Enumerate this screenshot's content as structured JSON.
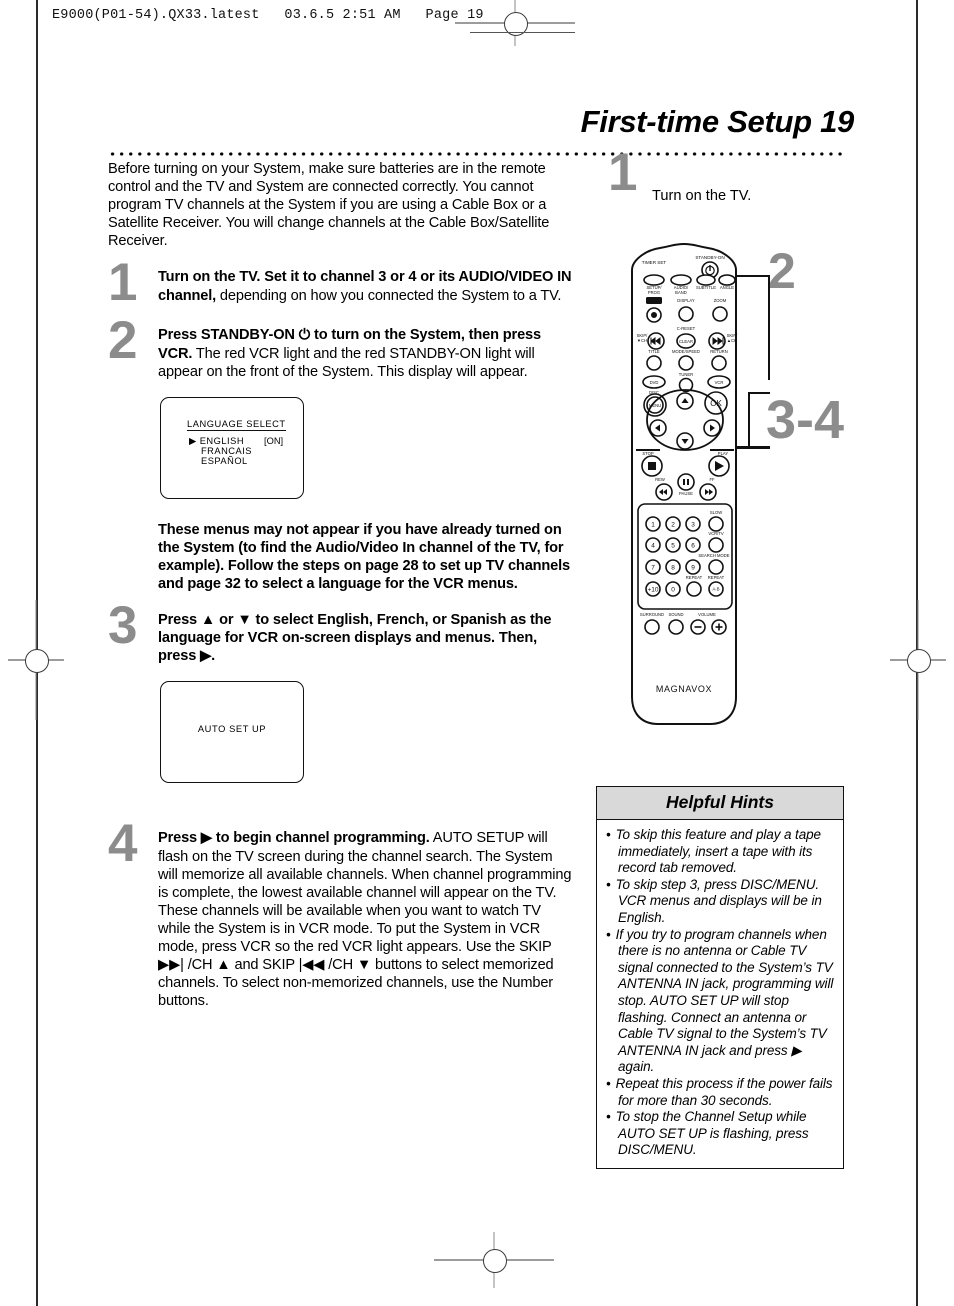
{
  "print_header": "E9000(P01-54).QX33.latest   03.6.5 2:51 AM   Page 19",
  "title": "First-time Setup  19",
  "intro": "Before turning on your System, make sure batteries are in the remote control and the TV and System are connected correctly. You cannot program TV channels at the System if you are using a Cable Box or a Satellite Receiver. You will change channels at the Cable Box/Satellite Receiver.",
  "steps": [
    {
      "number": "1",
      "bold": "Turn on the TV. Set it to channel 3 or 4 or its AUDIO/VIDEO IN channel,",
      "rest": " depending on how you connected the System to a TV."
    },
    {
      "number": "2",
      "bold": "Press STANDBY-ON ⏻ to turn on the System, then press VCR.",
      "rest": " The red VCR light and the red STANDBY-ON light will appear on the front of the System. This display will appear."
    },
    {
      "number": "3",
      "bold": "Press ▲ or ▼ to select English, French, or Spanish as the language for VCR on-screen displays and menus. Then, press ▶.",
      "rest": ""
    },
    {
      "number": "4",
      "bold": "Press ▶ to begin channel programming.",
      "rest": " AUTO SETUP will flash on the TV screen during the channel search. The System will memorize all available channels. When channel programming is complete, the lowest available channel will appear on the TV. These channels will be available when you want to watch TV while the System is in VCR mode. To put the System in VCR mode, press VCR so the red VCR light appears. Use the SKIP ▶▶| /CH ▲ and SKIP |◀◀ /CH ▼ buttons to select memorized channels. To select non-memorized channels, use the Number buttons."
    }
  ],
  "note": "These menus may not appear if you have already turned on the System (to find the Audio/Video In channel of the TV, for example). Follow the steps on page 28 to set up TV channels and page 32 to select a language for the VCR menus.",
  "osd_language": {
    "title": "LANGUAGE SELECT",
    "option1": "▶ ENGLISH",
    "option1_state": "[ON]",
    "option2": "FRANCAIS",
    "option3": "ESPAÑOL"
  },
  "osd_autosetup": {
    "text": "AUTO SET UP"
  },
  "right_column": {
    "step1_number": "1",
    "step1_text": "Turn on the TV.",
    "callout_standby": "2",
    "callout_dpad": "3-4"
  },
  "remote": {
    "brand": "MAGNAVOX",
    "labels": {
      "timer_set": "TIMER SET",
      "standby_on": "STANDBY-ON",
      "setup_prog": "SETUP/\nPROG",
      "audio_band": "AUDIO/\nBAND",
      "subtitle": "SUBTITLE",
      "angle": "ANGLE",
      "rec": "REC",
      "display": "DISPLAY",
      "zoom": "ZOOM",
      "c_reset": "C-RESET",
      "clear": "CLEAR",
      "skip_down": "SKIP/\n▼CH",
      "skip_up": "SKIP/\n▲CH",
      "title_btn": "TITLE",
      "mode_speed": "MODE/SPEED",
      "return_btn": "RETURN",
      "dvd": "DVD",
      "tuner": "TUNER",
      "vcr": "VCR",
      "disc": "DISC",
      "menu": "MENU",
      "ok": "OK",
      "stop": "STOP",
      "play": "PLAY",
      "rew": "REW",
      "pause": "PAUSE",
      "ff": "FF",
      "slow": "SLOW",
      "vcr_tv": "VCR/TV",
      "search_mode": "SEARCH MODE",
      "repeat": "REPEAT",
      "repeat_ab": "REPEAT\nA-B",
      "surround": "SURROUND",
      "sound": "SOUND",
      "volume": "VOLUME",
      "vol_minus": "−",
      "vol_plus": "+"
    },
    "numbers": [
      "1",
      "2",
      "3",
      "4",
      "5",
      "6",
      "7",
      "8",
      "9",
      "+10",
      "0"
    ]
  },
  "hints": {
    "header": "Helpful Hints",
    "items": [
      "To skip this feature and play a tape immediately, insert a tape with its record tab removed.",
      "To skip step 3, press DISC/MENU. VCR menus and displays will be in English.",
      "If you try to program channels when there is no antenna or Cable TV signal connected to the System’s TV ANTENNA IN jack, programming will stop. AUTO SET UP will stop flashing. Connect an antenna or Cable TV signal to the System’s TV ANTENNA IN jack and press ▶ again.",
      "Repeat this process if the power fails for more than 30 seconds.",
      "To stop the Channel Setup while AUTO SET UP is flashing, press DISC/MENU."
    ]
  }
}
